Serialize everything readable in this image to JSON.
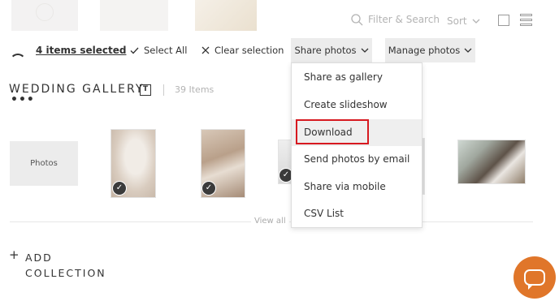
{
  "toolbar": {
    "search_placeholder": "Filter & Search",
    "sort_label": "Sort"
  },
  "selection_bar": {
    "items_selected": "4 items selected",
    "select_all": "Select All",
    "clear_selection": "Clear selection",
    "share_photos": "Share photos",
    "manage_photos": "Manage photos"
  },
  "gallery": {
    "title": "WEDDING GALLERY",
    "title_icon_letter": "T",
    "item_count": "39 Items",
    "card_label": "Photos",
    "view_all": "View all"
  },
  "add_collection": {
    "line1": "ADD",
    "line2": "COLLECTION"
  },
  "share_menu": {
    "items": [
      {
        "label": "Share as gallery"
      },
      {
        "label": "Create slideshow"
      },
      {
        "label": "Download"
      },
      {
        "label": "Send photos by email"
      },
      {
        "label": "Share via mobile"
      },
      {
        "label": "CSV List"
      }
    ],
    "highlighted_index": 2
  },
  "colors": {
    "accent_orange": "#e0762a",
    "highlight_red": "#d71920"
  },
  "icons": [
    "search-icon",
    "chevron-down-icon",
    "check-icon",
    "close-icon",
    "single-view-icon",
    "grid-view-icon",
    "chat-icon",
    "plus-icon"
  ]
}
